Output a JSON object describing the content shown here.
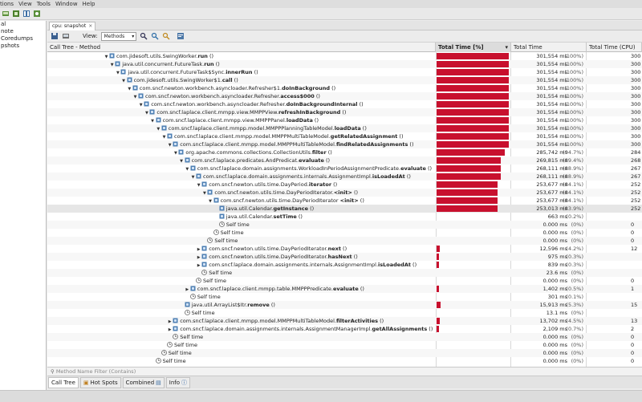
{
  "menu": [
    "tions",
    "View",
    "Tools",
    "Window",
    "Help"
  ],
  "left_panel": [
    "al",
    "note",
    "Coredumps",
    "pshots"
  ],
  "tab": {
    "label": "cpu: snapshot",
    "close": "×"
  },
  "toolbar": {
    "view_label": "View:",
    "view_value": "Methods"
  },
  "columns": {
    "method": "Call Tree - Method",
    "total_pct": "Total Time [%]",
    "total_time": "Total Time",
    "total_cpu": "Total Time (CPU)"
  },
  "rows": [
    {
      "indent": 0,
      "exp": "down",
      "icon": "method",
      "pre": "com.jidesoft.utils.SwingWorker.",
      "bold": "run",
      "post": " ()",
      "time": "301,554 ms",
      "pct": "(100%)",
      "frac": 1.0,
      "cpu": "300"
    },
    {
      "indent": 1,
      "exp": "down",
      "icon": "method",
      "pre": "java.util.concurrent.FutureTask.",
      "bold": "run",
      "post": " ()",
      "time": "301,554 ms",
      "pct": "(100%)",
      "frac": 1.0,
      "cpu": "300"
    },
    {
      "indent": 2,
      "exp": "down",
      "icon": "method",
      "pre": "java.util.concurrent.FutureTask$Sync.",
      "bold": "innerRun",
      "post": " ()",
      "time": "301,554 ms",
      "pct": "(100%)",
      "frac": 1.0,
      "cpu": "300"
    },
    {
      "indent": 3,
      "exp": "down",
      "icon": "method",
      "pre": "com.jidesoft.utils.SwingWorker$1.",
      "bold": "call",
      "post": " ()",
      "time": "301,554 ms",
      "pct": "(100%)",
      "frac": 1.0,
      "cpu": "300"
    },
    {
      "indent": 4,
      "exp": "down",
      "icon": "method",
      "pre": "com.sncf.newton.workbench.asyncloader.Refresher$1.",
      "bold": "doInBackground",
      "post": " ()",
      "time": "301,554 ms",
      "pct": "(100%)",
      "frac": 1.0,
      "cpu": "300"
    },
    {
      "indent": 5,
      "exp": "down",
      "icon": "method",
      "pre": "com.sncf.newton.workbench.asyncloader.Refresher.",
      "bold": "access$000",
      "post": " ()",
      "time": "301,554 ms",
      "pct": "(100%)",
      "frac": 1.0,
      "cpu": "300"
    },
    {
      "indent": 6,
      "exp": "down",
      "icon": "method",
      "pre": "com.sncf.newton.workbench.asyncloader.Refresher.",
      "bold": "doInBackgroundInternal",
      "post": " ()",
      "time": "301,554 ms",
      "pct": "(100%)",
      "frac": 1.0,
      "cpu": "300"
    },
    {
      "indent": 7,
      "exp": "down",
      "icon": "method",
      "pre": "com.sncf.laplace.client.mmpp.view.MMPPView.",
      "bold": "refreshInBackground",
      "post": " ()",
      "time": "301,554 ms",
      "pct": "(100%)",
      "frac": 1.0,
      "cpu": "300"
    },
    {
      "indent": 8,
      "exp": "down",
      "icon": "method",
      "pre": "com.sncf.laplace.client.mmpp.view.MMPPPanel.",
      "bold": "loadData",
      "post": " ()",
      "time": "301,554 ms",
      "pct": "(100%)",
      "frac": 1.0,
      "cpu": "300"
    },
    {
      "indent": 9,
      "exp": "down",
      "icon": "method",
      "pre": "com.sncf.laplace.client.mmpp.model.MMPPPlanningTableModel.",
      "bold": "loadData",
      "post": " ()",
      "time": "301,554 ms",
      "pct": "(100%)",
      "frac": 1.0,
      "cpu": "300"
    },
    {
      "indent": 10,
      "exp": "down",
      "icon": "method",
      "pre": "com.sncf.laplace.client.mmpp.model.MMPPMultiTableModel.",
      "bold": "getRelatedAssignment",
      "post": " ()",
      "time": "301,554 ms",
      "pct": "(100%)",
      "frac": 1.0,
      "cpu": "300"
    },
    {
      "indent": 11,
      "exp": "down",
      "icon": "method",
      "pre": "com.sncf.laplace.client.mmpp.model.MMPPMultiTableModel.",
      "bold": "findRelatedAssignments",
      "post": " ()",
      "time": "301,554 ms",
      "pct": "(100%)",
      "frac": 1.0,
      "cpu": "300"
    },
    {
      "indent": 12,
      "exp": "down",
      "icon": "method",
      "pre": "org.apache.commons.collections.CollectionUtils.",
      "bold": "filter",
      "post": " ()",
      "time": "285,742 ms",
      "pct": "(94.7%)",
      "frac": 0.947,
      "cpu": "284"
    },
    {
      "indent": 13,
      "exp": "down",
      "icon": "method",
      "pre": "com.sncf.laplace.predicates.AndPredicat.",
      "bold": "evaluate",
      "post": " ()",
      "time": "269,815 ms",
      "pct": "(89.4%)",
      "frac": 0.894,
      "cpu": "268"
    },
    {
      "indent": 14,
      "exp": "down",
      "icon": "method",
      "pre": "com.sncf.laplace.domain.assignments.WorkloadInPeriodAssignmentPredicate.",
      "bold": "evaluate",
      "post": " ()",
      "time": "268,111 ms",
      "pct": "(88.9%)",
      "frac": 0.889,
      "cpu": "267"
    },
    {
      "indent": 15,
      "exp": "down",
      "icon": "method",
      "pre": "com.sncf.laplace.domain.assignments.internals.AssignmentImpl.",
      "bold": "isLoadedAt",
      "post": " ()",
      "time": "268,111 ms",
      "pct": "(88.9%)",
      "frac": 0.889,
      "cpu": "267"
    },
    {
      "indent": 16,
      "exp": "down",
      "icon": "method",
      "pre": "com.sncf.newton.utils.time.DayPeriod.",
      "bold": "iterator",
      "post": " ()",
      "time": "253,677 ms",
      "pct": "(84.1%)",
      "frac": 0.841,
      "cpu": "252"
    },
    {
      "indent": 17,
      "exp": "down",
      "icon": "method",
      "pre": "com.sncf.newton.utils.time.DayPeriodIterator.",
      "bold": "<init>",
      "post": " ()",
      "time": "253,677 ms",
      "pct": "(84.1%)",
      "frac": 0.841,
      "cpu": "252"
    },
    {
      "indent": 18,
      "exp": "down",
      "icon": "method",
      "pre": "com.sncf.newton.utils.time.DayPeriodIterator ",
      "bold": "<init>",
      "post": " ()",
      "time": "253,677 ms",
      "pct": "(84.1%)",
      "frac": 0.841,
      "cpu": "252"
    },
    {
      "indent": 19,
      "exp": "none",
      "icon": "method",
      "pre": "java.util.Calendar.",
      "bold": "getInstance",
      "post": " ()",
      "time": "253,013 ms",
      "pct": "(83.9%)",
      "frac": 0.839,
      "cpu": "252",
      "sel": true
    },
    {
      "indent": 19,
      "exp": "none",
      "icon": "method",
      "pre": "java.util.Calendar.",
      "bold": "setTime",
      "post": " ()",
      "time": "663 ms",
      "pct": "(0.2%)",
      "frac": 0.0,
      "cpu": ""
    },
    {
      "indent": 19,
      "exp": "none",
      "icon": "self",
      "pre": "Self time",
      "bold": "",
      "post": "",
      "time": "0.000 ms",
      "pct": "(0%)",
      "frac": 0.0,
      "cpu": "0"
    },
    {
      "indent": 18,
      "exp": "none",
      "icon": "self",
      "pre": "Self time",
      "bold": "",
      "post": "",
      "time": "0.000 ms",
      "pct": "(0%)",
      "frac": 0.0,
      "cpu": "0"
    },
    {
      "indent": 17,
      "exp": "none",
      "icon": "self",
      "pre": "Self time",
      "bold": "",
      "post": "",
      "time": "0.000 ms",
      "pct": "(0%)",
      "frac": 0.0,
      "cpu": "0"
    },
    {
      "indent": 16,
      "exp": "right",
      "icon": "method",
      "pre": "com.sncf.newton.utils.time.DayPeriodIterator.",
      "bold": "next",
      "post": " ()",
      "time": "12,596 ms",
      "pct": "(4.2%)",
      "frac": 0.042,
      "cpu": "12"
    },
    {
      "indent": 16,
      "exp": "right",
      "icon": "method",
      "pre": "com.sncf.newton.utils.time.DayPeriodIterator.",
      "bold": "hasNext",
      "post": " ()",
      "time": "975 ms",
      "pct": "(0.3%)",
      "frac": 0.003,
      "cpu": ""
    },
    {
      "indent": 16,
      "exp": "right",
      "icon": "method",
      "pre": "com.sncf.laplace.domain.assignments.internals.AssignmentImpl.",
      "bold": "isLoadedAt",
      "post": " ()",
      "time": "839 ms",
      "pct": "(0.3%)",
      "frac": 0.003,
      "cpu": ""
    },
    {
      "indent": 16,
      "exp": "none",
      "icon": "self",
      "pre": "Self time",
      "bold": "",
      "post": "",
      "time": "23.6 ms",
      "pct": "(0%)",
      "frac": 0.0,
      "cpu": ""
    },
    {
      "indent": 15,
      "exp": "none",
      "icon": "self",
      "pre": "Self time",
      "bold": "",
      "post": "",
      "time": "0.000 ms",
      "pct": "(0%)",
      "frac": 0.0,
      "cpu": "0"
    },
    {
      "indent": 14,
      "exp": "right",
      "icon": "method",
      "pre": "com.sncf.laplace.client.mmpp.table.MMPPPredicate.",
      "bold": "evaluate",
      "post": " ()",
      "time": "1,402 ms",
      "pct": "(0.5%)",
      "frac": 0.005,
      "cpu": "1"
    },
    {
      "indent": 14,
      "exp": "none",
      "icon": "self",
      "pre": "Self time",
      "bold": "",
      "post": "",
      "time": "301 ms",
      "pct": "(0.1%)",
      "frac": 0.0,
      "cpu": ""
    },
    {
      "indent": 13,
      "exp": "none",
      "icon": "method",
      "pre": "java.util.ArrayList$Itr.",
      "bold": "remove",
      "post": " ()",
      "time": "15,913 ms",
      "pct": "(5.3%)",
      "frac": 0.053,
      "cpu": "15"
    },
    {
      "indent": 13,
      "exp": "none",
      "icon": "self",
      "pre": "Self time",
      "bold": "",
      "post": "",
      "time": "13.1 ms",
      "pct": "(0%)",
      "frac": 0.0,
      "cpu": ""
    },
    {
      "indent": 11,
      "exp": "right",
      "icon": "method",
      "pre": "com.sncf.laplace.client.mmpp.model.MMPPMultiTableModel.",
      "bold": "filterActivities",
      "post": " ()",
      "time": "13,702 ms",
      "pct": "(4.5%)",
      "frac": 0.045,
      "cpu": "13"
    },
    {
      "indent": 11,
      "exp": "right",
      "icon": "method",
      "pre": "com.sncf.laplace.domain.assignments.internals.AssignmentManagerImpl.",
      "bold": "getAllAssignments",
      "post": " ()",
      "time": "2,109 ms",
      "pct": "(0.7%)",
      "frac": 0.007,
      "cpu": "2"
    },
    {
      "indent": 11,
      "exp": "none",
      "icon": "self",
      "pre": "Self time",
      "bold": "",
      "post": "",
      "time": "0.000 ms",
      "pct": "(0%)",
      "frac": 0.0,
      "cpu": "0"
    },
    {
      "indent": 10,
      "exp": "none",
      "icon": "self",
      "pre": "Self time",
      "bold": "",
      "post": "",
      "time": "0.000 ms",
      "pct": "(0%)",
      "frac": 0.0,
      "cpu": "0"
    },
    {
      "indent": 9,
      "exp": "none",
      "icon": "self",
      "pre": "Self time",
      "bold": "",
      "post": "",
      "time": "0.000 ms",
      "pct": "(0%)",
      "frac": 0.0,
      "cpu": "0"
    },
    {
      "indent": 8,
      "exp": "none",
      "icon": "self",
      "pre": "Self time",
      "bold": "",
      "post": "",
      "time": "0.000 ms",
      "pct": "(0%)",
      "frac": 0.0,
      "cpu": "0"
    }
  ],
  "filter_placeholder": "Method Name Filter (Contains)",
  "bottom_tabs": [
    "Call Tree",
    "Hot Spots",
    "Combined",
    "Info"
  ],
  "colors": {
    "bar": "#c8102e",
    "selected_row": "#e6e6e6"
  }
}
